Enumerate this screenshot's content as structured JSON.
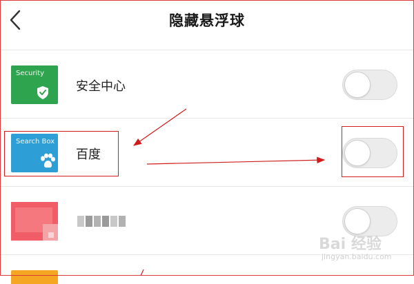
{
  "header": {
    "title": "隐藏悬浮球"
  },
  "items": [
    {
      "icon_caption": "Security",
      "icon_color": "#2fa44f",
      "icon_name": "shield-check-icon",
      "label": "安全中心",
      "toggle_on": false
    },
    {
      "icon_caption": "Search Box",
      "icon_color": "#2d9fd6",
      "icon_name": "paw-icon",
      "label": "百度",
      "toggle_on": false
    },
    {
      "icon_caption": "",
      "icon_color": "#f05d66",
      "icon_name": "blurred-app-icon",
      "label": "",
      "toggle_on": false
    },
    {
      "icon_caption": "",
      "icon_color": "#f5a623",
      "icon_name": "app-icon",
      "label": "",
      "toggle_on": false
    }
  ],
  "annotation_color": "#d11a1a",
  "watermark": {
    "logo": "Bai 经验",
    "url": "jingyan.baidu.com"
  }
}
